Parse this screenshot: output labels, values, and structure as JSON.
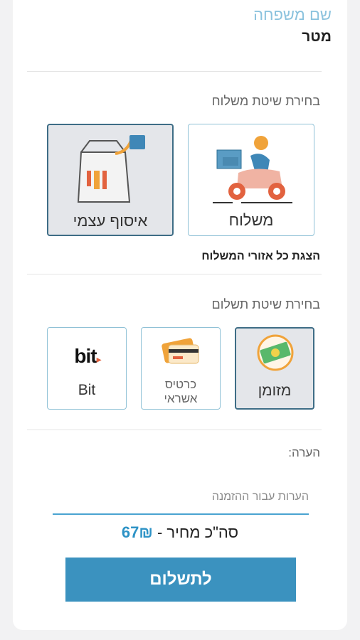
{
  "profile": {
    "last_name_label": "שם משפחה",
    "last_name_value": "מטר"
  },
  "delivery": {
    "title": "בחירת שיטת משלוח",
    "options": [
      {
        "label": "משלוח",
        "icon": "scooter-courier-icon",
        "selected": false
      },
      {
        "label": "איסוף עצמי",
        "icon": "takeaway-bag-icon",
        "selected": true
      }
    ],
    "areas_link": "הצגת כל אזורי המשלוח"
  },
  "payment": {
    "title": "בחירת שיטת תשלום",
    "options": [
      {
        "label": "מזומן",
        "icon": "cash-icon",
        "selected": true
      },
      {
        "label": "כרטיס אשראי",
        "icon": "credit-card-icon",
        "selected": false
      },
      {
        "label": "Bit",
        "logo_text": "bit",
        "icon": "bit-logo-icon",
        "selected": false
      }
    ]
  },
  "note": {
    "label": "הערה:",
    "placeholder": "הערות עבור ההזמנה",
    "value": ""
  },
  "total": {
    "label": "סה\"כ מחיר -",
    "amount": "67₪"
  },
  "pay_button": {
    "label": "לתשלום"
  },
  "colors": {
    "accent": "#3b92bf",
    "selected_border": "#3e6d86",
    "option_border": "#8fc1d6",
    "label_blue": "#8cc3de"
  }
}
